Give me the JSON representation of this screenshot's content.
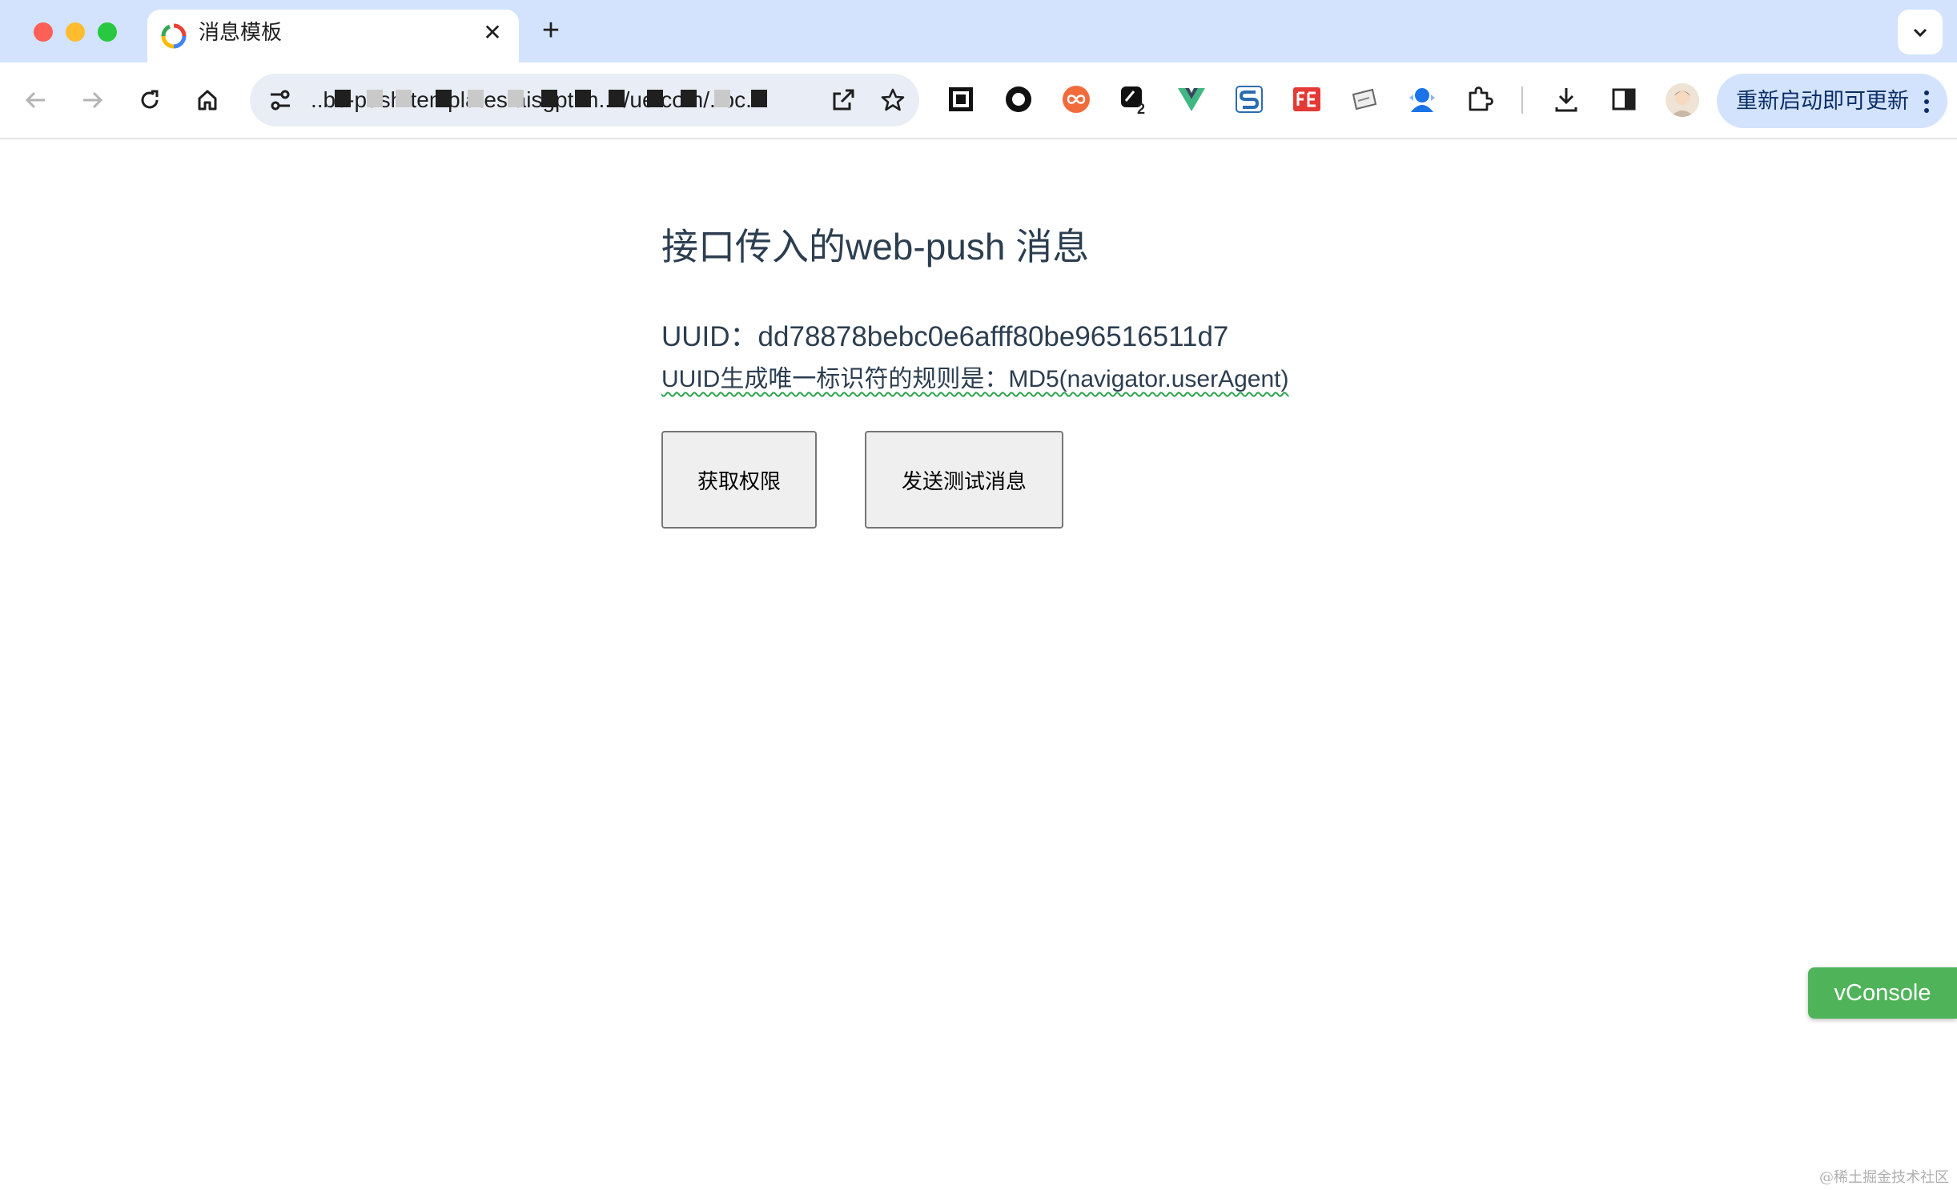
{
  "tab": {
    "title": "消息模板",
    "close_glyph": "✕",
    "new_tab_glyph": "+"
  },
  "address_bar": {
    "url": "..bc-push-templates.aisgpt.m..../ue.com/..bc..."
  },
  "toolbar": {
    "extension_badge": "2",
    "update_button_label": "重新启动即可更新"
  },
  "page": {
    "title": "接口传入的web-push 消息",
    "uuid_text": "UUID：dd78878bebc0e6afff80be96516511d7",
    "uuid_rule_text": "UUID生成唯一标识符的规则是：MD5(navigator.userAgent)",
    "buttons": {
      "get_permission": "获取权限",
      "send_test": "发送测试消息"
    }
  },
  "vconsole": {
    "label": "vConsole"
  },
  "watermark": "@稀土掘金技术社区",
  "colors": {
    "tabstrip": "#d3e3fd",
    "text_primary": "#2c3e50",
    "vconsole": "#4fb35a",
    "update_button": "#d3e3fd"
  },
  "icons": [
    "back-arrow-icon",
    "forward-arrow-icon",
    "reload-icon",
    "home-icon",
    "site-info-icon",
    "open-external-icon",
    "bookmark-star-icon",
    "extensions-puzzle-icon",
    "download-icon",
    "side-panel-icon",
    "more-vert-icon",
    "tab-search-icon"
  ]
}
